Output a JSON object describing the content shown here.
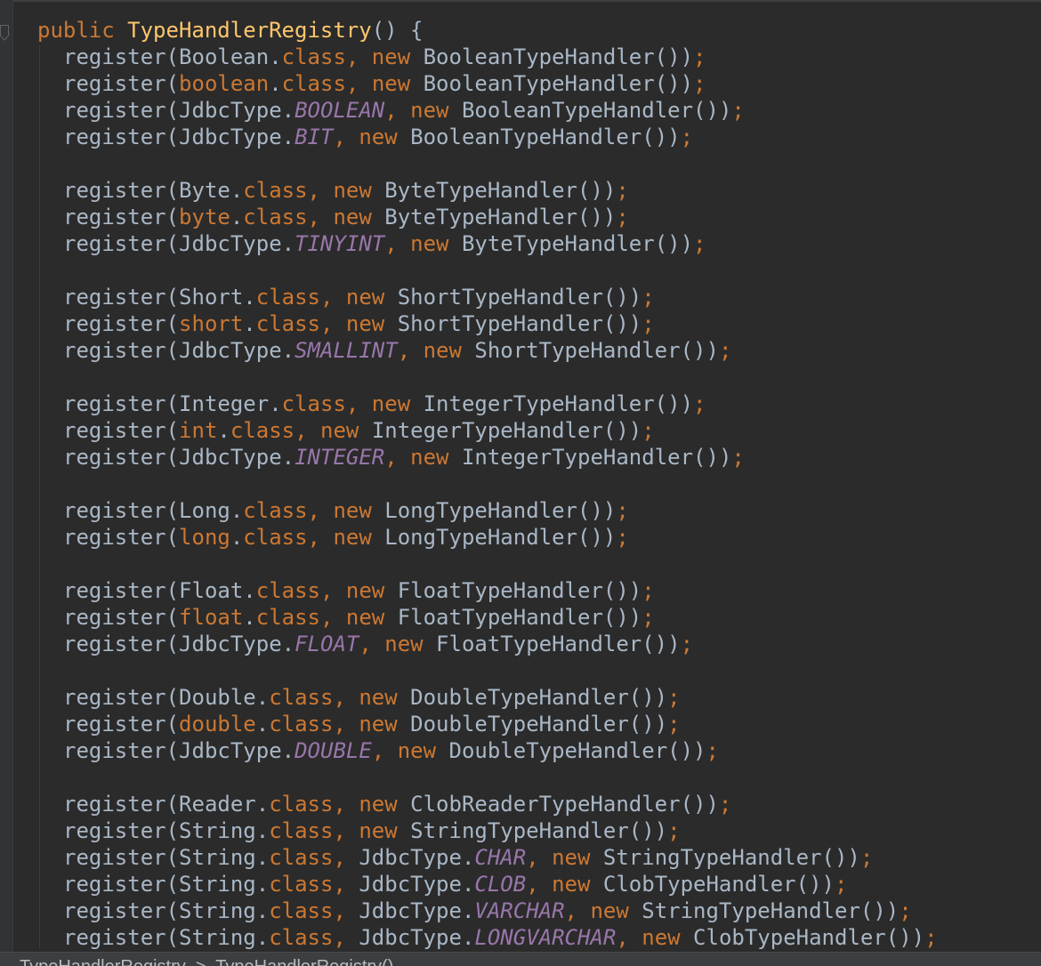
{
  "editor": {
    "method_line": [
      {
        "t": "public ",
        "c": "kw"
      },
      {
        "t": "TypeHandlerRegistry",
        "c": "fn"
      },
      {
        "t": "() {",
        "c": "plain"
      }
    ],
    "body_lines": [
      [
        {
          "t": "register(Boolean.",
          "c": "plain"
        },
        {
          "t": "class",
          "c": "kw"
        },
        {
          "t": ", ",
          "c": "kw"
        },
        {
          "t": "new ",
          "c": "kw"
        },
        {
          "t": "BooleanTypeHandler())",
          "c": "plain"
        },
        {
          "t": ";",
          "c": "kw"
        }
      ],
      [
        {
          "t": "register(",
          "c": "plain"
        },
        {
          "t": "boolean",
          "c": "kw"
        },
        {
          "t": ".",
          "c": "plain"
        },
        {
          "t": "class",
          "c": "kw"
        },
        {
          "t": ", ",
          "c": "kw"
        },
        {
          "t": "new ",
          "c": "kw"
        },
        {
          "t": "BooleanTypeHandler())",
          "c": "plain"
        },
        {
          "t": ";",
          "c": "kw"
        }
      ],
      [
        {
          "t": "register(JdbcType.",
          "c": "plain"
        },
        {
          "t": "BOOLEAN",
          "c": "cst"
        },
        {
          "t": ", ",
          "c": "kw"
        },
        {
          "t": "new ",
          "c": "kw"
        },
        {
          "t": "BooleanTypeHandler())",
          "c": "plain"
        },
        {
          "t": ";",
          "c": "kw"
        }
      ],
      [
        {
          "t": "register(JdbcType.",
          "c": "plain"
        },
        {
          "t": "BIT",
          "c": "cst"
        },
        {
          "t": ", ",
          "c": "kw"
        },
        {
          "t": "new ",
          "c": "kw"
        },
        {
          "t": "BooleanTypeHandler())",
          "c": "plain"
        },
        {
          "t": ";",
          "c": "kw"
        }
      ],
      [],
      [
        {
          "t": "register(Byte.",
          "c": "plain"
        },
        {
          "t": "class",
          "c": "kw"
        },
        {
          "t": ", ",
          "c": "kw"
        },
        {
          "t": "new ",
          "c": "kw"
        },
        {
          "t": "ByteTypeHandler())",
          "c": "plain"
        },
        {
          "t": ";",
          "c": "kw"
        }
      ],
      [
        {
          "t": "register(",
          "c": "plain"
        },
        {
          "t": "byte",
          "c": "kw"
        },
        {
          "t": ".",
          "c": "plain"
        },
        {
          "t": "class",
          "c": "kw"
        },
        {
          "t": ", ",
          "c": "kw"
        },
        {
          "t": "new ",
          "c": "kw"
        },
        {
          "t": "ByteTypeHandler())",
          "c": "plain"
        },
        {
          "t": ";",
          "c": "kw"
        }
      ],
      [
        {
          "t": "register(JdbcType.",
          "c": "plain"
        },
        {
          "t": "TINYINT",
          "c": "cst"
        },
        {
          "t": ", ",
          "c": "kw"
        },
        {
          "t": "new ",
          "c": "kw"
        },
        {
          "t": "ByteTypeHandler())",
          "c": "plain"
        },
        {
          "t": ";",
          "c": "kw"
        }
      ],
      [],
      [
        {
          "t": "register(Short.",
          "c": "plain"
        },
        {
          "t": "class",
          "c": "kw"
        },
        {
          "t": ", ",
          "c": "kw"
        },
        {
          "t": "new ",
          "c": "kw"
        },
        {
          "t": "ShortTypeHandler())",
          "c": "plain"
        },
        {
          "t": ";",
          "c": "kw"
        }
      ],
      [
        {
          "t": "register(",
          "c": "plain"
        },
        {
          "t": "short",
          "c": "kw"
        },
        {
          "t": ".",
          "c": "plain"
        },
        {
          "t": "class",
          "c": "kw"
        },
        {
          "t": ", ",
          "c": "kw"
        },
        {
          "t": "new ",
          "c": "kw"
        },
        {
          "t": "ShortTypeHandler())",
          "c": "plain"
        },
        {
          "t": ";",
          "c": "kw"
        }
      ],
      [
        {
          "t": "register(JdbcType.",
          "c": "plain"
        },
        {
          "t": "SMALLINT",
          "c": "cst"
        },
        {
          "t": ", ",
          "c": "kw"
        },
        {
          "t": "new ",
          "c": "kw"
        },
        {
          "t": "ShortTypeHandler())",
          "c": "plain"
        },
        {
          "t": ";",
          "c": "kw"
        }
      ],
      [],
      [
        {
          "t": "register(Integer.",
          "c": "plain"
        },
        {
          "t": "class",
          "c": "kw"
        },
        {
          "t": ", ",
          "c": "kw"
        },
        {
          "t": "new ",
          "c": "kw"
        },
        {
          "t": "IntegerTypeHandler())",
          "c": "plain"
        },
        {
          "t": ";",
          "c": "kw"
        }
      ],
      [
        {
          "t": "register(",
          "c": "plain"
        },
        {
          "t": "int",
          "c": "kw"
        },
        {
          "t": ".",
          "c": "plain"
        },
        {
          "t": "class",
          "c": "kw"
        },
        {
          "t": ", ",
          "c": "kw"
        },
        {
          "t": "new ",
          "c": "kw"
        },
        {
          "t": "IntegerTypeHandler())",
          "c": "plain"
        },
        {
          "t": ";",
          "c": "kw"
        }
      ],
      [
        {
          "t": "register(JdbcType.",
          "c": "plain"
        },
        {
          "t": "INTEGER",
          "c": "cst"
        },
        {
          "t": ", ",
          "c": "kw"
        },
        {
          "t": "new ",
          "c": "kw"
        },
        {
          "t": "IntegerTypeHandler())",
          "c": "plain"
        },
        {
          "t": ";",
          "c": "kw"
        }
      ],
      [],
      [
        {
          "t": "register(Long.",
          "c": "plain"
        },
        {
          "t": "class",
          "c": "kw"
        },
        {
          "t": ", ",
          "c": "kw"
        },
        {
          "t": "new ",
          "c": "kw"
        },
        {
          "t": "LongTypeHandler())",
          "c": "plain"
        },
        {
          "t": ";",
          "c": "kw"
        }
      ],
      [
        {
          "t": "register(",
          "c": "plain"
        },
        {
          "t": "long",
          "c": "kw"
        },
        {
          "t": ".",
          "c": "plain"
        },
        {
          "t": "class",
          "c": "kw"
        },
        {
          "t": ", ",
          "c": "kw"
        },
        {
          "t": "new ",
          "c": "kw"
        },
        {
          "t": "LongTypeHandler())",
          "c": "plain"
        },
        {
          "t": ";",
          "c": "kw"
        }
      ],
      [],
      [
        {
          "t": "register(Float.",
          "c": "plain"
        },
        {
          "t": "class",
          "c": "kw"
        },
        {
          "t": ", ",
          "c": "kw"
        },
        {
          "t": "new ",
          "c": "kw"
        },
        {
          "t": "FloatTypeHandler())",
          "c": "plain"
        },
        {
          "t": ";",
          "c": "kw"
        }
      ],
      [
        {
          "t": "register(",
          "c": "plain"
        },
        {
          "t": "float",
          "c": "kw"
        },
        {
          "t": ".",
          "c": "plain"
        },
        {
          "t": "class",
          "c": "kw"
        },
        {
          "t": ", ",
          "c": "kw"
        },
        {
          "t": "new ",
          "c": "kw"
        },
        {
          "t": "FloatTypeHandler())",
          "c": "plain"
        },
        {
          "t": ";",
          "c": "kw"
        }
      ],
      [
        {
          "t": "register(JdbcType.",
          "c": "plain"
        },
        {
          "t": "FLOAT",
          "c": "cst"
        },
        {
          "t": ", ",
          "c": "kw"
        },
        {
          "t": "new ",
          "c": "kw"
        },
        {
          "t": "FloatTypeHandler())",
          "c": "plain"
        },
        {
          "t": ";",
          "c": "kw"
        }
      ],
      [],
      [
        {
          "t": "register(Double.",
          "c": "plain"
        },
        {
          "t": "class",
          "c": "kw"
        },
        {
          "t": ", ",
          "c": "kw"
        },
        {
          "t": "new ",
          "c": "kw"
        },
        {
          "t": "DoubleTypeHandler())",
          "c": "plain"
        },
        {
          "t": ";",
          "c": "kw"
        }
      ],
      [
        {
          "t": "register(",
          "c": "plain"
        },
        {
          "t": "double",
          "c": "kw"
        },
        {
          "t": ".",
          "c": "plain"
        },
        {
          "t": "class",
          "c": "kw"
        },
        {
          "t": ", ",
          "c": "kw"
        },
        {
          "t": "new ",
          "c": "kw"
        },
        {
          "t": "DoubleTypeHandler())",
          "c": "plain"
        },
        {
          "t": ";",
          "c": "kw"
        }
      ],
      [
        {
          "t": "register(JdbcType.",
          "c": "plain"
        },
        {
          "t": "DOUBLE",
          "c": "cst"
        },
        {
          "t": ", ",
          "c": "kw"
        },
        {
          "t": "new ",
          "c": "kw"
        },
        {
          "t": "DoubleTypeHandler())",
          "c": "plain"
        },
        {
          "t": ";",
          "c": "kw"
        }
      ],
      [],
      [
        {
          "t": "register(Reader.",
          "c": "plain"
        },
        {
          "t": "class",
          "c": "kw"
        },
        {
          "t": ", ",
          "c": "kw"
        },
        {
          "t": "new ",
          "c": "kw"
        },
        {
          "t": "ClobReaderTypeHandler())",
          "c": "plain"
        },
        {
          "t": ";",
          "c": "kw"
        }
      ],
      [
        {
          "t": "register(String.",
          "c": "plain"
        },
        {
          "t": "class",
          "c": "kw"
        },
        {
          "t": ", ",
          "c": "kw"
        },
        {
          "t": "new ",
          "c": "kw"
        },
        {
          "t": "StringTypeHandler())",
          "c": "plain"
        },
        {
          "t": ";",
          "c": "kw"
        }
      ],
      [
        {
          "t": "register(String.",
          "c": "plain"
        },
        {
          "t": "class",
          "c": "kw"
        },
        {
          "t": ", ",
          "c": "kw"
        },
        {
          "t": "JdbcType.",
          "c": "plain"
        },
        {
          "t": "CHAR",
          "c": "cst"
        },
        {
          "t": ", ",
          "c": "kw"
        },
        {
          "t": "new ",
          "c": "kw"
        },
        {
          "t": "StringTypeHandler())",
          "c": "plain"
        },
        {
          "t": ";",
          "c": "kw"
        }
      ],
      [
        {
          "t": "register(String.",
          "c": "plain"
        },
        {
          "t": "class",
          "c": "kw"
        },
        {
          "t": ", ",
          "c": "kw"
        },
        {
          "t": "JdbcType.",
          "c": "plain"
        },
        {
          "t": "CLOB",
          "c": "cst"
        },
        {
          "t": ", ",
          "c": "kw"
        },
        {
          "t": "new ",
          "c": "kw"
        },
        {
          "t": "ClobTypeHandler())",
          "c": "plain"
        },
        {
          "t": ";",
          "c": "kw"
        }
      ],
      [
        {
          "t": "register(String.",
          "c": "plain"
        },
        {
          "t": "class",
          "c": "kw"
        },
        {
          "t": ", ",
          "c": "kw"
        },
        {
          "t": "JdbcType.",
          "c": "plain"
        },
        {
          "t": "VARCHAR",
          "c": "cst"
        },
        {
          "t": ", ",
          "c": "kw"
        },
        {
          "t": "new ",
          "c": "kw"
        },
        {
          "t": "StringTypeHandler())",
          "c": "plain"
        },
        {
          "t": ";",
          "c": "kw"
        }
      ],
      [
        {
          "t": "register(String.",
          "c": "plain"
        },
        {
          "t": "class",
          "c": "kw"
        },
        {
          "t": ", ",
          "c": "kw"
        },
        {
          "t": "JdbcType.",
          "c": "plain"
        },
        {
          "t": "LONGVARCHAR",
          "c": "cst"
        },
        {
          "t": ", ",
          "c": "kw"
        },
        {
          "t": "new ",
          "c": "kw"
        },
        {
          "t": "ClobTypeHandler())",
          "c": "plain"
        },
        {
          "t": ";",
          "c": "kw"
        }
      ]
    ]
  },
  "status_bar": {
    "breadcrumb": "TypeHandlerRegistry  >  TypeHandlerRegistry()"
  },
  "colors": {
    "background": "#2b2b2b",
    "keyword": "#cc7832",
    "method": "#ffc66d",
    "constant": "#9876aa",
    "text": "#a9b7c6"
  },
  "icons": {
    "fold_marker": "fold-collapse-icon"
  }
}
